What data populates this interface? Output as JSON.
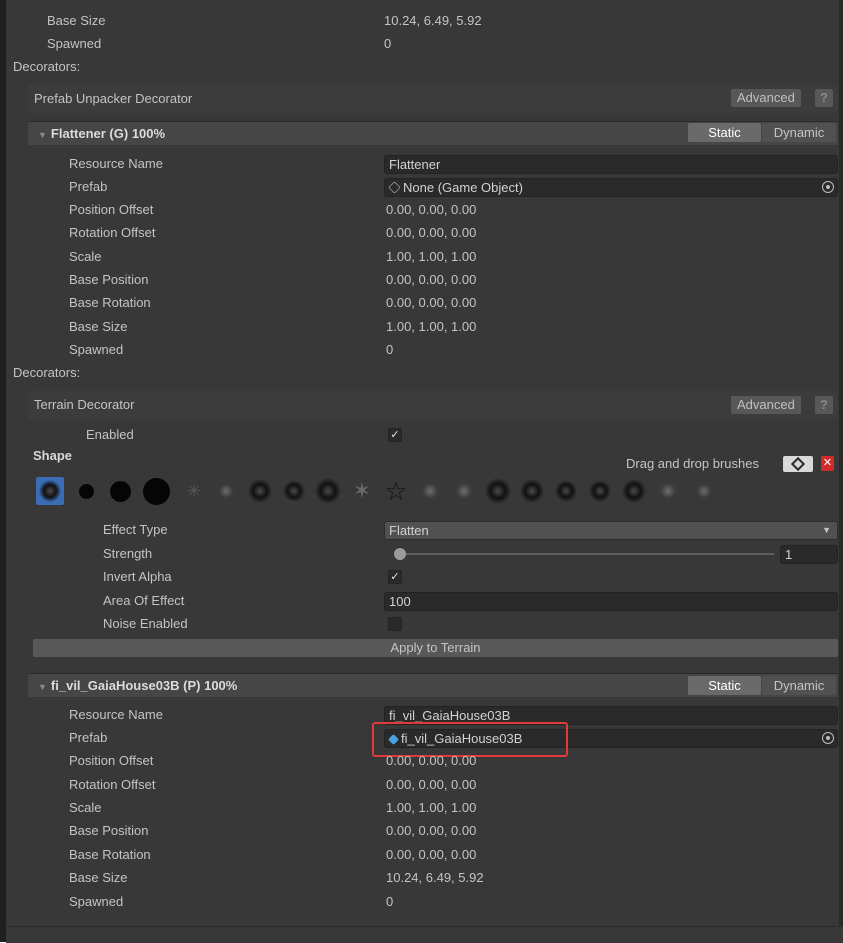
{
  "top_group": {
    "rows": [
      {
        "label": "Base Size",
        "value": "10.24, 6.49, 5.92"
      },
      {
        "label": "Spawned",
        "value": "0"
      }
    ],
    "decorators_label": "Decorators:",
    "decorator_title": "Prefab Unpacker Decorator",
    "advanced_label": "Advanced",
    "help_label": "?"
  },
  "flattener": {
    "title": "Flattener (G) 100%",
    "static_label": "Static",
    "dynamic_label": "Dynamic",
    "resource_name_label": "Resource Name",
    "resource_name_value": "Flattener",
    "prefab_label": "Prefab",
    "prefab_value": "None (Game Object)",
    "rows": [
      {
        "label": "Position Offset",
        "value": "0.00, 0.00, 0.00"
      },
      {
        "label": "Rotation Offset",
        "value": "0.00, 0.00, 0.00"
      },
      {
        "label": "Scale",
        "value": "1.00, 1.00, 1.00"
      },
      {
        "label": "Base Position",
        "value": "0.00, 0.00, 0.00"
      },
      {
        "label": "Base Rotation",
        "value": "0.00, 0.00, 0.00"
      },
      {
        "label": "Base Size",
        "value": "1.00, 1.00, 1.00"
      },
      {
        "label": "Spawned",
        "value": "0"
      }
    ],
    "decorators_label": "Decorators:",
    "terrain_decorator_title": "Terrain Decorator",
    "advanced_label": "Advanced",
    "help_label": "?",
    "enabled_label": "Enabled",
    "enabled_checked": true,
    "shape_label": "Shape",
    "drag_drop_label": "Drag and drop brushes",
    "effect_type_label": "Effect Type",
    "effect_type_value": "Flatten",
    "strength_label": "Strength",
    "strength_value": "1",
    "strength_fraction": 0.0,
    "invert_alpha_label": "Invert Alpha",
    "invert_alpha_checked": true,
    "area_of_effect_label": "Area Of Effect",
    "area_of_effect_value": "100",
    "noise_enabled_label": "Noise Enabled",
    "noise_enabled_checked": false,
    "apply_button_label": "Apply to Terrain"
  },
  "house": {
    "title": "fi_vil_GaiaHouse03B (P) 100%",
    "static_label": "Static",
    "dynamic_label": "Dynamic",
    "resource_name_label": "Resource Name",
    "resource_name_value": "fi_vil_GaiaHouse03B",
    "prefab_label": "Prefab",
    "prefab_value": "fi_vil_GaiaHouse03B",
    "rows": [
      {
        "label": "Position Offset",
        "value": "0.00, 0.00, 0.00"
      },
      {
        "label": "Rotation Offset",
        "value": "0.00, 0.00, 0.00"
      },
      {
        "label": "Scale",
        "value": "1.00, 1.00, 1.00"
      },
      {
        "label": "Base Position",
        "value": "0.00, 0.00, 0.00"
      },
      {
        "label": "Base Rotation",
        "value": "0.00, 0.00, 0.00"
      },
      {
        "label": "Base Size",
        "value": "10.24, 6.49, 5.92"
      },
      {
        "label": "Spawned",
        "value": "0"
      }
    ]
  },
  "colors": {
    "panel": "#383838",
    "field": "#2a2a2a",
    "highlight_box": "#e03a3a",
    "selected_brush": "#3b6db5",
    "prefab_icon": "#4aa3df"
  }
}
